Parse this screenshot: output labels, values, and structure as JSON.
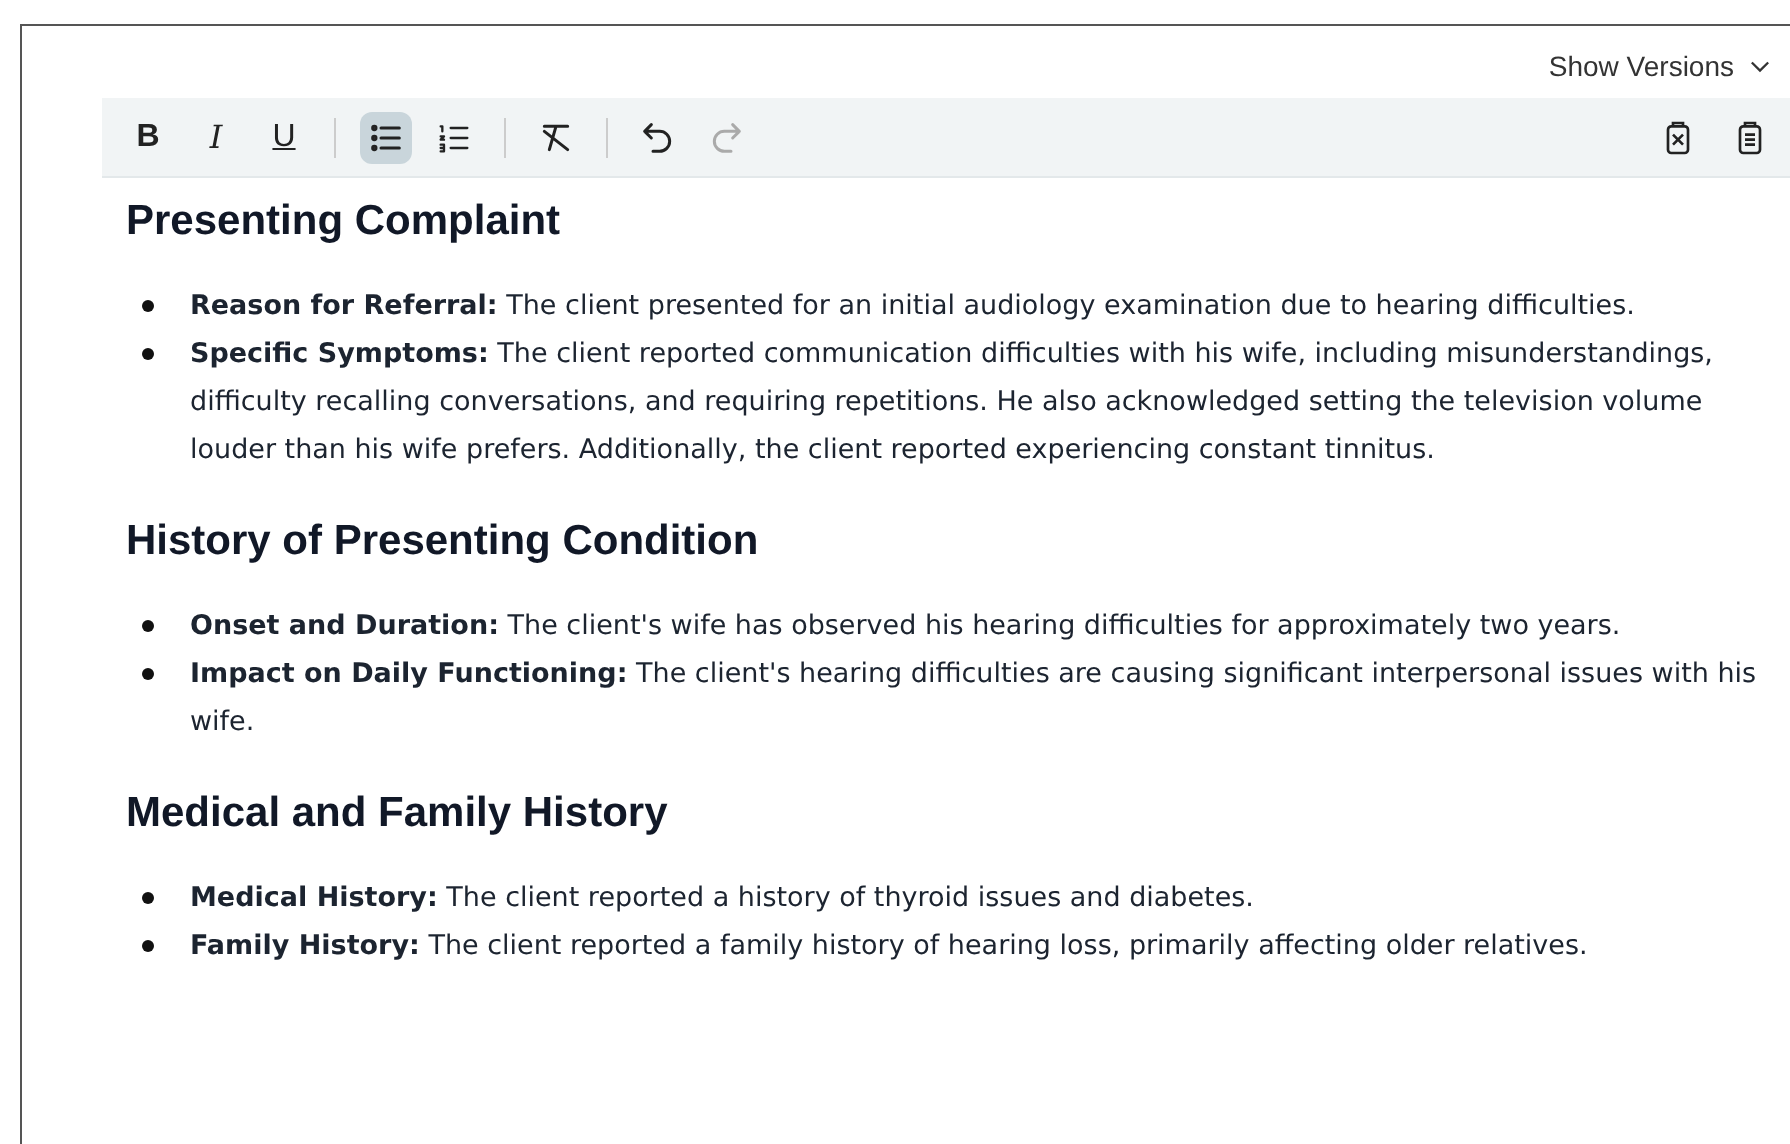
{
  "versions_button": {
    "label": "Show Versions"
  },
  "toolbar": [
    {
      "kind": "bold",
      "label": "B",
      "selected": false,
      "disabled": false
    },
    {
      "kind": "italic",
      "label": "I",
      "selected": false,
      "disabled": false
    },
    {
      "kind": "underline",
      "label": "U",
      "selected": false,
      "disabled": false
    },
    {
      "kind": "divider"
    },
    {
      "kind": "bullet-list",
      "selected": true,
      "disabled": false
    },
    {
      "kind": "numbered-list",
      "selected": false,
      "disabled": false
    },
    {
      "kind": "divider"
    },
    {
      "kind": "clear-format",
      "selected": false,
      "disabled": false
    },
    {
      "kind": "divider"
    },
    {
      "kind": "undo",
      "selected": false,
      "disabled": false
    },
    {
      "kind": "redo",
      "selected": false,
      "disabled": true
    }
  ],
  "sections": [
    {
      "heading": "Presenting Complaint",
      "items": [
        "**Reason for Referral:** The client presented for an initial audiology examination due to hearing difficulties.",
        "**Specific Symptoms:** The client reported communication difficulties with his wife, including misunderstandings, difficulty recalling conversations, and requiring repetitions. He also acknowledged setting the television volume louder than his wife prefers. Additionally, the client reported experiencing constant tinnitus."
      ]
    },
    {
      "heading": "History of Presenting Condition",
      "items": [
        "**Onset and Duration:** The client's wife has observed his hearing difficulties for approximately two years.",
        "**Impact on Daily Functioning:** The client's hearing difficulties are causing significant interpersonal issues with his wife."
      ]
    },
    {
      "heading": "Medical and Family History",
      "items": [
        "**Medical History:** The client reported a history of thyroid issues and diabetes.",
        "**Family History:** The client reported a family history of hearing loss, primarily affecting older relatives."
      ]
    }
  ]
}
